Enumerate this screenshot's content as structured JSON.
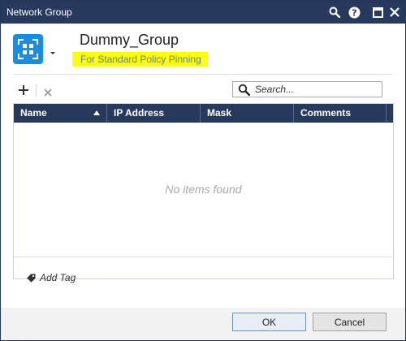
{
  "window": {
    "title": "Network Group",
    "title_buttons": [
      "search-icon",
      "help-icon",
      "maximize-icon",
      "close-icon"
    ],
    "titlebar_color": "#273a5e"
  },
  "header": {
    "object_icon": "network-group-icon",
    "object_name": "Dummy_Group",
    "comment": "For Standard Policy Pinning",
    "comment_highlight": "#ffff00"
  },
  "toolbar": {
    "add_icon": "plus-icon",
    "remove_icon": "x-icon",
    "search_placeholder": "Search..."
  },
  "table": {
    "columns": [
      "Name",
      "IP Address",
      "Mask",
      "Comments"
    ],
    "sorted_column": "Name",
    "sort_direction": "ascending",
    "rows": [],
    "empty_message": "No items found"
  },
  "tags": {
    "add_tag_label": "Add Tag",
    "tag_icon": "tag-icon"
  },
  "buttons": {
    "ok_label": "OK",
    "cancel_label": "Cancel"
  },
  "colors": {
    "accent": "#1a8de0",
    "header_bg": "#273a5e"
  }
}
